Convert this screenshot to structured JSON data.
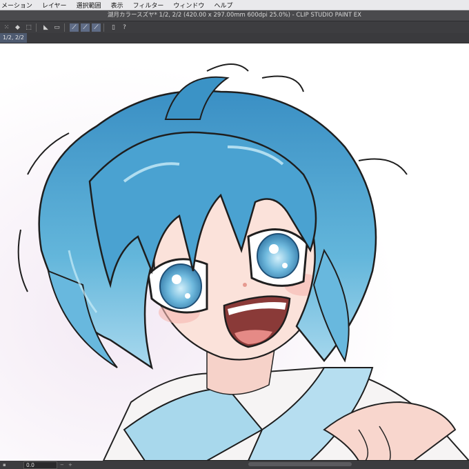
{
  "menu": {
    "items": [
      "メーション",
      "レイヤー",
      "選択範囲",
      "表示",
      "フィルター",
      "ウィンドウ",
      "ヘルプ"
    ]
  },
  "window": {
    "title": "湖月カラースズヤ* 1/2, 2/2 (420.00 x 297.00mm 600dpi 25.0%)  - CLIP STUDIO PAINT EX"
  },
  "tab": {
    "label": "1/2, 2/2"
  },
  "toolbar": {
    "icons": [
      "snap-icon",
      "fill-icon",
      "transform-icon",
      "ruler-icon",
      "ruler-edit-icon",
      "ruler-snap-icon",
      "ruler-special-icon",
      "ruler-grid-icon",
      "device-icon",
      "help-icon"
    ]
  },
  "status": {
    "zoom": "0.0"
  },
  "colors": {
    "accent": "#5f6c86",
    "hair": "#5fb2d8",
    "hair_dark": "#2f7fb5",
    "skin": "#fbe2da",
    "collar": "#a8d8ec"
  }
}
